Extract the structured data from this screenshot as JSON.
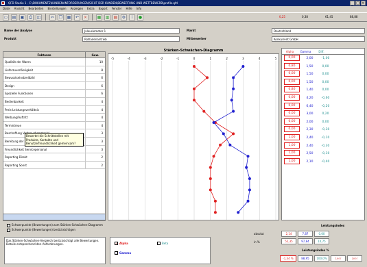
{
  "window": {
    "title": "QFD Studio 1 - C:\\DOKUMENTE\\KUNDENANFORDERUNGEN\\SICHT DER KUNDEN\\BEWERTUNG UND WETTBEWERB\\profile.qfd",
    "min": "_",
    "max": "□",
    "close": "×"
  },
  "menu": [
    "Datei",
    "Ansicht",
    "Bearbeiten",
    "Einstellungen",
    "Anzeigen",
    "Extra",
    "Export",
    "Fenster",
    "Hilfe",
    "Info"
  ],
  "toolbar": {
    "icons": [
      "new-icon",
      "open-icon",
      "save-icon",
      "print-icon",
      "preview-icon",
      "cut-icon",
      "copy-icon",
      "paste-icon",
      "undo-icon",
      "delete-icon",
      "grid-icon",
      "chart-icon",
      "table-icon",
      "settings-icon",
      "info-icon",
      "go-icon"
    ],
    "values": [
      "0,25",
      "0,38",
      "61,45",
      "88,88"
    ]
  },
  "form": {
    "analysis_label": "Name der Analyse",
    "analysis_value": "Jalousiemotor 1",
    "product_label": "Produkt",
    "product_value": "Rollladenantrieb",
    "market_label": "Markt",
    "market_value": "Deutschland",
    "competitor_label": "Mitbewerber",
    "competitor_value": "Konkurrent GmbH"
  },
  "left_table": {
    "col1": "Faktoren",
    "col2": "Gew.",
    "rows": [
      {
        "name": "Qualität der Waren",
        "w": "10"
      },
      {
        "name": "Lieferzuverlässigkeit",
        "w": "8"
      },
      {
        "name": "Bewusstseinsbreitbild",
        "w": "6"
      },
      {
        "name": "Design",
        "w": "6"
      },
      {
        "name": "Spezielle Funktionen",
        "w": "6"
      },
      {
        "name": "Bedienbarkeit",
        "w": "4"
      },
      {
        "name": "Preis-Leistungsverhältnis",
        "w": "4"
      },
      {
        "name": "Werbung/Auftritt",
        "w": "4"
      },
      {
        "name": "Termintreue",
        "w": "4"
      },
      {
        "name": "Beschaffung Verbrauchsmaterial",
        "w": "3"
      },
      {
        "name": "Bereitung der Rosenfall",
        "w": "3"
      },
      {
        "name": "Freundlichkeit Servicepersonal",
        "w": "3"
      },
      {
        "name": "Reporting Direkt",
        "w": "2"
      },
      {
        "name": "Reporting Sonst",
        "w": "2"
      }
    ]
  },
  "tooltip": "Bewertet die Schnittstellen mit Produkte, Kontakte und Benutzerfreundlichkeit gemeinsam?",
  "chart": {
    "title": "Stärken-Schwächen-Diagramm",
    "axis_labels": [
      "-5",
      "-4",
      "-3",
      "-2",
      "-1",
      "0",
      "1",
      "2",
      "3",
      "4",
      "5"
    ],
    "series_names": [
      "Alpha",
      "Gamma"
    ]
  },
  "chart_data": {
    "type": "line",
    "title": "Stärken-Schwächen-Diagramm",
    "xlim": [
      -5,
      5
    ],
    "categories": [
      "Qualität der Waren",
      "Lieferzuverlässigkeit",
      "Bewusstseinsbreitbild",
      "Design",
      "Spezielle Funktionen",
      "Bedienbarkeit",
      "Preis-Leistungsverhältnis",
      "Werbung/Auftritt",
      "Termintreue",
      "Beschaffung Verbrauchsmaterial",
      "Bereitung der Rosenfall",
      "Freundlichkeit Servicepersonal",
      "Reporting Direkt",
      "Reporting Sonst"
    ],
    "series": [
      {
        "name": "Alpha",
        "color": "#e02020",
        "values": [
          0.0,
          0.8,
          0.0,
          0.0,
          0.6,
          1.3,
          2.4,
          1.6,
          1.2,
          1.0,
          1.0,
          1.0,
          1.3,
          1.3
        ]
      },
      {
        "name": "Gamma",
        "color": "#2020d0",
        "values": [
          3.0,
          2.4,
          2.4,
          2.3,
          2.4,
          1.2,
          1.8,
          2.2,
          3.3,
          3.2,
          3.4,
          3.4,
          3.3,
          2.7
        ]
      }
    ]
  },
  "right_table": {
    "headers": [
      "Alpha",
      "Gamma",
      "Diff."
    ],
    "rows": [
      [
        "0,00",
        "2,00",
        "-1,00"
      ],
      [
        "0,80",
        "1,50",
        "0,00"
      ],
      [
        "0,00",
        "1,50",
        "0,00"
      ],
      [
        "0,00",
        "1,50",
        "0,00"
      ],
      [
        "0,80",
        "1,40",
        "0,00"
      ],
      [
        "0,00",
        "4,20",
        "-0,60"
      ],
      [
        "0,00",
        "6,40",
        "-0,20"
      ],
      [
        "0,00",
        "3,00",
        "0,20"
      ],
      [
        "0,00",
        "2,00",
        "0,00"
      ],
      [
        "0,00",
        "2,30",
        "-0,30"
      ],
      [
        "1,00",
        "2,40",
        "-0,10"
      ],
      [
        "1,00",
        "2,40",
        "-0,30"
      ],
      [
        "1,00",
        "2,50",
        "-0,10"
      ],
      [
        "1,00",
        "2,10",
        "-0,40"
      ]
    ]
  },
  "checks": {
    "opt1": "Schwerpunkte (Bewertungen) zum Stärken-Schwächen-Diagramm",
    "opt2": "Schwerpunkte (Bewertungen) berücksichtigen"
  },
  "memo": "Das Stärken-Schwächen-Vergleich berücksichtigt alle Bewertungen. Details entsprechend den Anforderungen.",
  "legend": {
    "alpha": "Alpha",
    "gamma": "Gamma",
    "beta": "Beta"
  },
  "summary": {
    "title1": "Leistungsindex",
    "title2": "Leistungsindex %",
    "label_abs": "absolut",
    "label_pct": "in %",
    "abs_values": [
      "2,14",
      "7,87",
      "0,00"
    ],
    "pct_values": [
      "52,35",
      "97,84",
      "10,75"
    ],
    "idx_values": [
      "-1,34 %",
      "88,95",
      "100,0%",
      "Leer",
      "Leer"
    ]
  }
}
